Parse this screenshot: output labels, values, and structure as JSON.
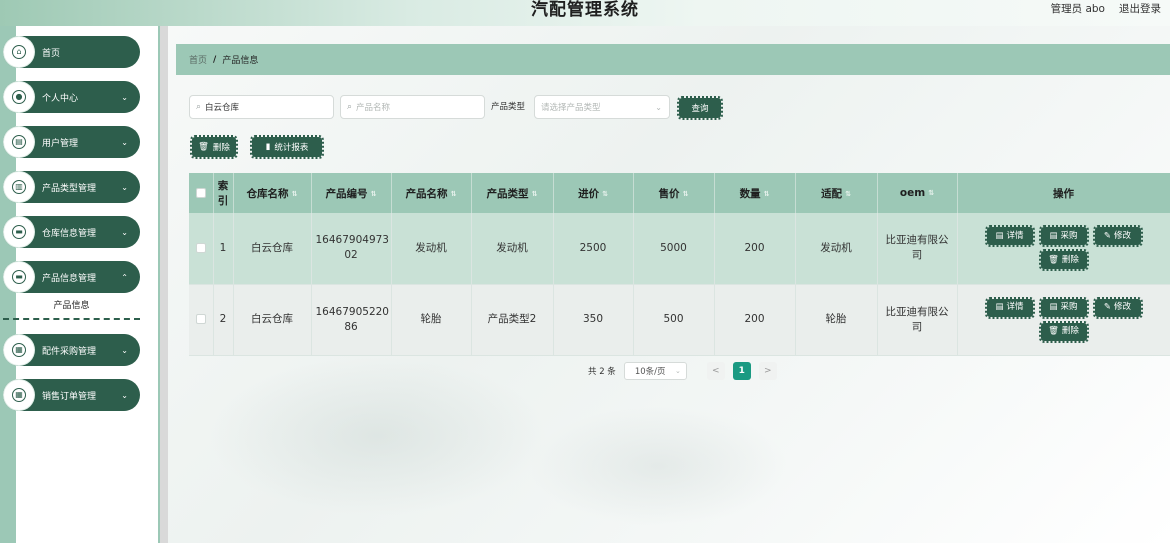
{
  "header": {
    "title": "汽配管理系统",
    "admin_label": "管理员 abo",
    "logout_label": "退出登录"
  },
  "sidebar": {
    "items": [
      {
        "label": "首页",
        "icon": "home-icon",
        "has_chevron": false
      },
      {
        "label": "个人中心",
        "icon": "user-icon",
        "has_chevron": true
      },
      {
        "label": "用户管理",
        "icon": "users-icon",
        "has_chevron": true
      },
      {
        "label": "产品类型管理",
        "icon": "chart-icon",
        "has_chevron": true
      },
      {
        "label": "仓库信息管理",
        "icon": "monitor-icon",
        "has_chevron": true
      },
      {
        "label": "产品信息管理",
        "icon": "monitor-icon",
        "has_chevron": true
      },
      {
        "label": "配件采购管理",
        "icon": "grid-icon",
        "has_chevron": true
      },
      {
        "label": "销售订单管理",
        "icon": "grid-icon",
        "has_chevron": true
      }
    ],
    "submenu_active": "产品信息"
  },
  "breadcrumb": {
    "home": "首页",
    "separator": "/",
    "current": "产品信息"
  },
  "search": {
    "warehouse_value": "白云仓库",
    "product_name_placeholder": "产品名称",
    "type_label": "产品类型",
    "type_placeholder": "请选择产品类型",
    "query_button": "查询"
  },
  "actions": {
    "delete_label": "删除",
    "stats_label": "统计报表"
  },
  "table": {
    "columns": [
      "索引",
      "仓库名称",
      "产品编号",
      "产品名称",
      "产品类型",
      "进价",
      "售价",
      "数量",
      "适配",
      "oem",
      "操作"
    ],
    "rows": [
      {
        "index": "1",
        "warehouse": "白云仓库",
        "code": "16467904973 02",
        "name": "发动机",
        "type": "发动机",
        "cost": "2500",
        "price": "5000",
        "qty": "200",
        "fit": "发动机",
        "oem": "比亚迪有限公 司"
      },
      {
        "index": "2",
        "warehouse": "白云仓库",
        "code": "16467905220 86",
        "name": "轮胎",
        "type": "产品类型2",
        "cost": "350",
        "price": "500",
        "qty": "200",
        "fit": "轮胎",
        "oem": "比亚迪有限公 司"
      }
    ],
    "row_actions": {
      "detail": "详情",
      "purchase": "采购",
      "edit": "修改",
      "delete": "删除"
    }
  },
  "pagination": {
    "total_label": "共 2 条",
    "page_size": "10条/页",
    "prev": "<",
    "current_page": "1",
    "next": ">"
  },
  "colors": {
    "accent": "#2d5e4c",
    "header_bg": "#9cc8b6",
    "active_page": "#1a9a82"
  }
}
